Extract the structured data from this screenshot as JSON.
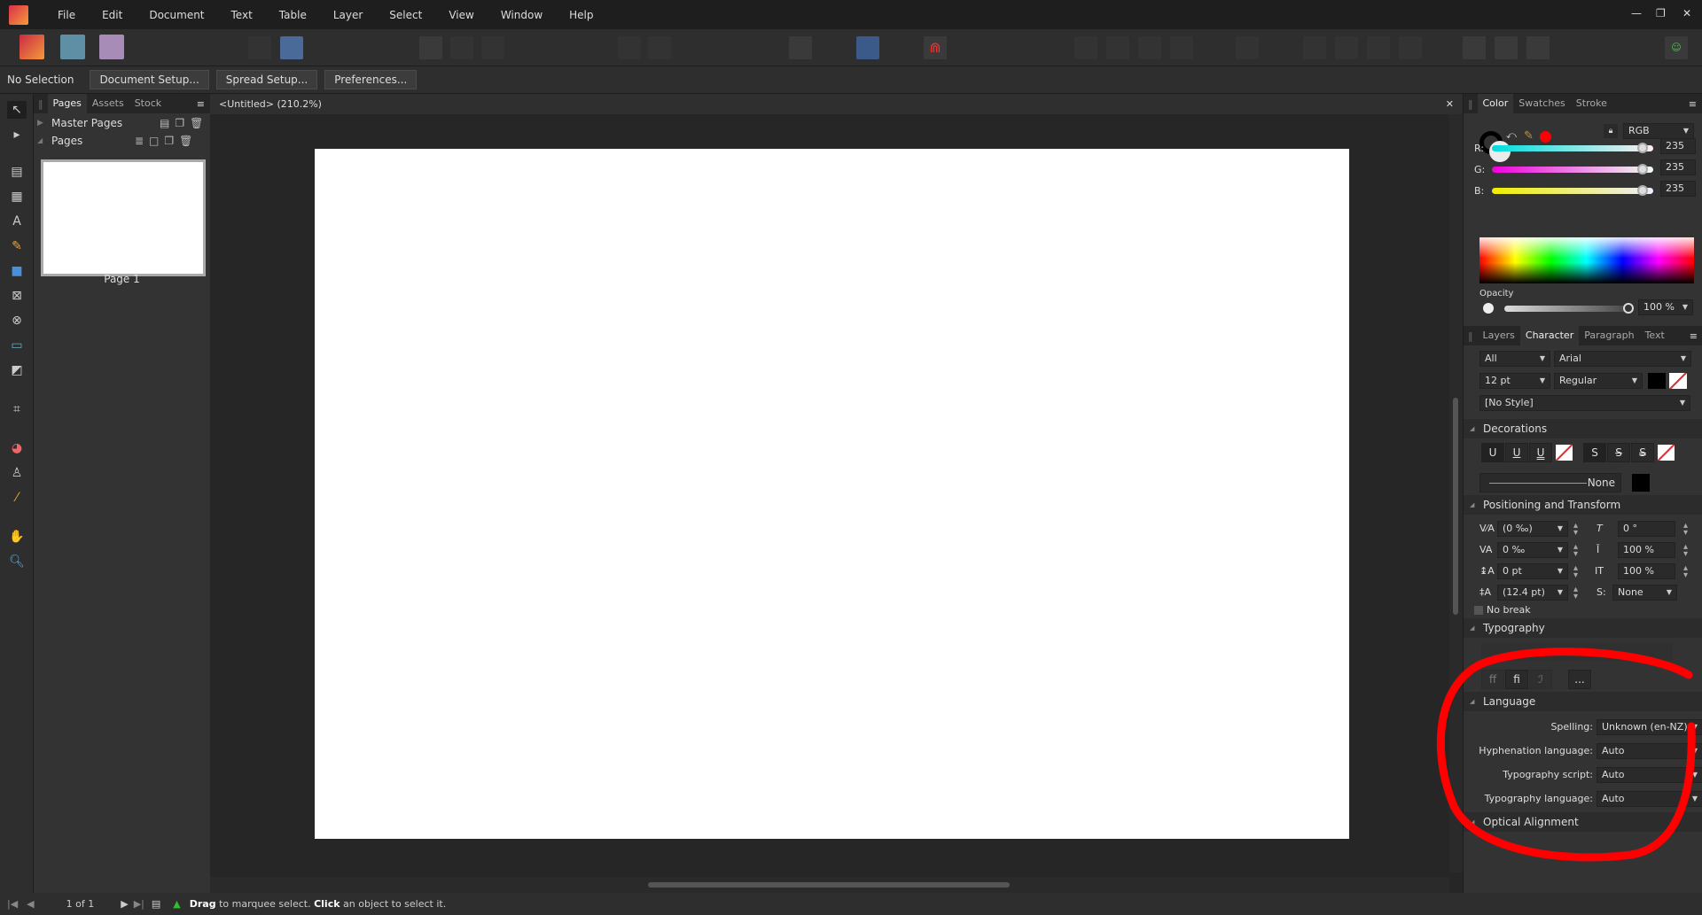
{
  "menu": [
    "File",
    "Edit",
    "Document",
    "Text",
    "Table",
    "Layer",
    "Select",
    "View",
    "Window",
    "Help"
  ],
  "context": {
    "selection": "No Selection",
    "buttons": [
      "Document Setup...",
      "Spread Setup...",
      "Preferences..."
    ]
  },
  "left_panel": {
    "tabs": [
      "Pages",
      "Assets",
      "Stock"
    ],
    "master_pages": "Master Pages",
    "pages": "Pages",
    "page_label": "Page 1"
  },
  "document": {
    "tab_title": "<Untitled> (210.2%)"
  },
  "color_panel": {
    "tabs": [
      "Color",
      "Swatches",
      "Stroke"
    ],
    "mode": "RGB",
    "r_label": "R:",
    "g_label": "G:",
    "b_label": "B:",
    "r": "235",
    "g": "235",
    "b": "235",
    "r_fraction": 0.92,
    "opacity_label": "Opacity",
    "opacity": "100 %",
    "accent_swatch": "#ff0000"
  },
  "character_panel": {
    "tabs": [
      "Layers",
      "Character",
      "Paragraph",
      "Text Styles"
    ],
    "font_collection": "All",
    "font": "Arial",
    "size": "12 pt",
    "weight": "Regular",
    "style": "[No Style]",
    "decorations": {
      "title": "Decorations",
      "underline_buttons": [
        "U",
        "U",
        "U"
      ],
      "strike_buttons": [
        "S",
        "S",
        "S"
      ],
      "line": "None"
    },
    "positioning": {
      "title": "Positioning and Transform",
      "tracking": "(0 ‰)",
      "kerning": "0 ‰",
      "baseline": "0 pt",
      "leading": "(12.4 pt)",
      "skew": "0 °",
      "vscale": "100 %",
      "hscale": "100 %",
      "s_label": "S:",
      "s_value": "None",
      "no_break": "No break"
    },
    "typography": {
      "title": "Typography",
      "more": "..."
    },
    "language": {
      "title": "Language",
      "rows": [
        {
          "label": "Spelling:",
          "value": "Unknown (en-NZ)"
        },
        {
          "label": "Hyphenation language:",
          "value": "Auto"
        },
        {
          "label": "Typography script:",
          "value": "Auto"
        },
        {
          "label": "Typography language:",
          "value": "Auto"
        }
      ]
    },
    "optical": {
      "title": "Optical Alignment"
    }
  },
  "status": {
    "page": "1 of 1",
    "hint_bold1": "Drag",
    "hint1": " to marquee select. ",
    "hint_bold2": "Click",
    "hint2": " an object to select it."
  },
  "annotation_color": "#ff0000"
}
